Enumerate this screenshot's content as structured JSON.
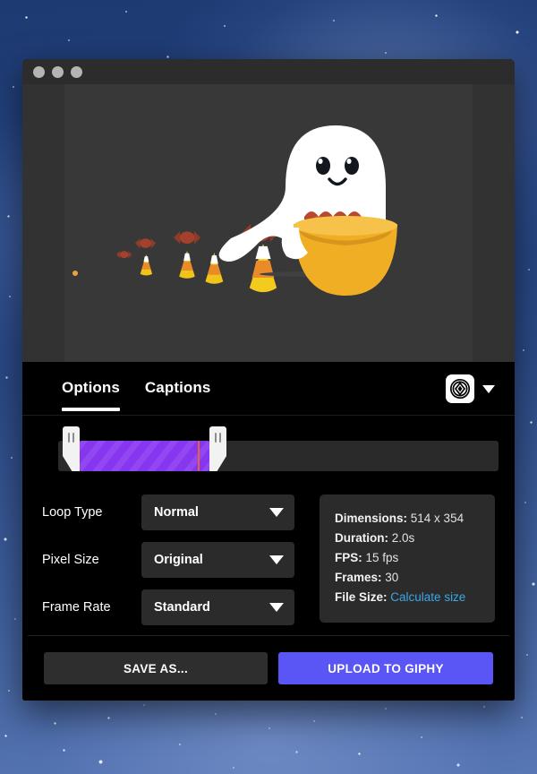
{
  "window": {
    "traffic_lights": [
      "close",
      "minimize",
      "zoom"
    ]
  },
  "preview": {
    "alt": "animated ghost holding candy bowl with candy corn trail",
    "background_color": "#383838"
  },
  "tabs": {
    "items": [
      {
        "label": "Options",
        "active": true
      },
      {
        "label": "Captions",
        "active": false
      }
    ],
    "gravity_icon": "gravity-target-icon",
    "gravity_caret_icon": "chevron-down-icon"
  },
  "timeline": {
    "selection_start_percent": 5,
    "selection_width_percent": 29,
    "playhead_percent": 32,
    "handle_icon": "grip-handle-icon",
    "selection_color": "#8736f0",
    "track_color": "#2a2a2a",
    "playhead_color": "#e8603c"
  },
  "options": [
    {
      "label": "Loop Type",
      "value": "Normal",
      "caret": "chevron-down-icon"
    },
    {
      "label": "Pixel Size",
      "value": "Original",
      "caret": "chevron-down-icon"
    },
    {
      "label": "Frame Rate",
      "value": "Standard",
      "caret": "chevron-down-icon"
    }
  ],
  "info": {
    "dimensions_key": "Dimensions:",
    "dimensions_value": "514 x 354",
    "duration_key": "Duration:",
    "duration_value": "2.0s",
    "fps_key": "FPS:",
    "fps_value": "15 fps",
    "frames_key": "Frames:",
    "frames_value": "30",
    "filesize_key": "File Size:",
    "filesize_link": "Calculate size",
    "link_color": "#3ba7e8"
  },
  "footer": {
    "save_label": "SAVE AS...",
    "upload_label": "UPLOAD TO GIPHY",
    "upload_color": "#5a55f5"
  }
}
